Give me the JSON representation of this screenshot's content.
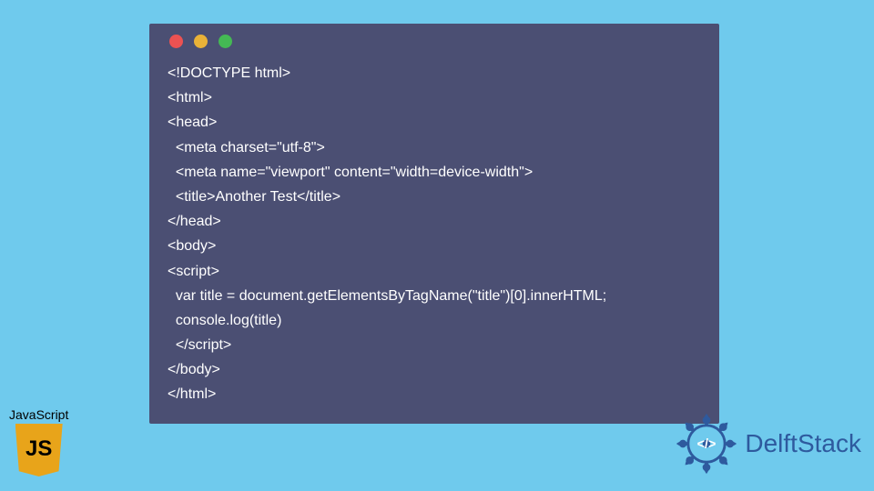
{
  "code": {
    "lines": [
      "<!DOCTYPE html>",
      "<html>",
      "<head>",
      "  <meta charset=\"utf-8\">",
      "  <meta name=\"viewport\" content=\"width=device-width\">",
      "  <title>Another Test</title>",
      "</head>",
      "<body>",
      "<script>",
      "  var title = document.getElementsByTagName(\"title\")[0].innerHTML;",
      "  console.log(title)",
      "  </script>",
      "</body>",
      "</html>"
    ]
  },
  "js_logo": {
    "label": "JavaScript"
  },
  "delft": {
    "brand": "DelftStack"
  }
}
